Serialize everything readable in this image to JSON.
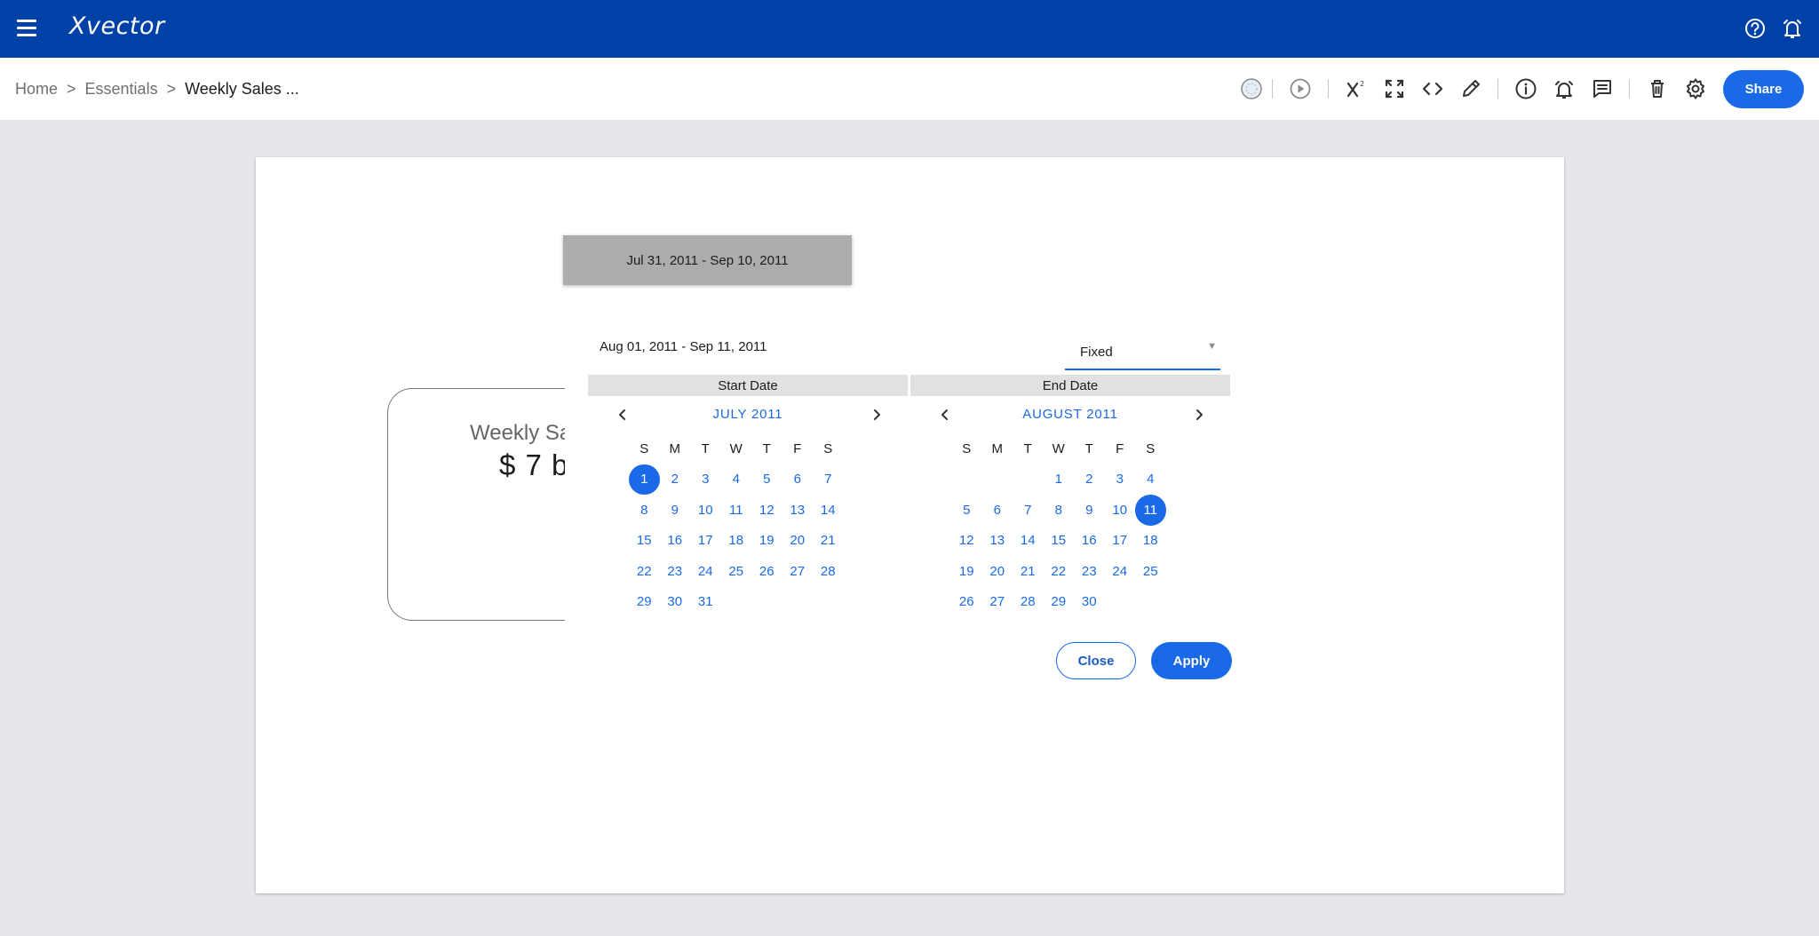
{
  "app": {
    "brand": "Xvector"
  },
  "breadcrumb": {
    "items": [
      "Home",
      "Essentials"
    ],
    "separator": ">",
    "current": "Weekly Sales ..."
  },
  "toolbar": {
    "icons": [
      "status-icon",
      "play-icon",
      "superscript-icon",
      "fullscreen-icon",
      "code-icon",
      "pencil-icon",
      "info-icon",
      "alert-icon",
      "comment-icon",
      "trash-icon",
      "settings-icon"
    ],
    "share_label": "Share"
  },
  "filter": {
    "chip_label": "Jul 31, 2011 - Sep 10, 2011"
  },
  "kpi": {
    "title": "Weekly Sa",
    "value": "$ 7 b"
  },
  "picker": {
    "range_text": "Aug 01, 2011 - Sep 11, 2011",
    "mode": "Fixed",
    "start": {
      "header": "Start Date",
      "month": "JULY 2011",
      "weekdays": [
        "S",
        "M",
        "T",
        "W",
        "T",
        "F",
        "S"
      ],
      "leading_blanks": 0,
      "days": 31,
      "selected": 1
    },
    "end": {
      "header": "End Date",
      "month": "AUGUST 2011",
      "weekdays": [
        "S",
        "M",
        "T",
        "W",
        "T",
        "F",
        "S"
      ],
      "leading_blanks": 3,
      "days": 30,
      "selected": 11
    },
    "close_label": "Close",
    "apply_label": "Apply"
  },
  "colors": {
    "topbar": "#0041a8",
    "accent": "#1a6ae8",
    "chip": "#acacac"
  }
}
